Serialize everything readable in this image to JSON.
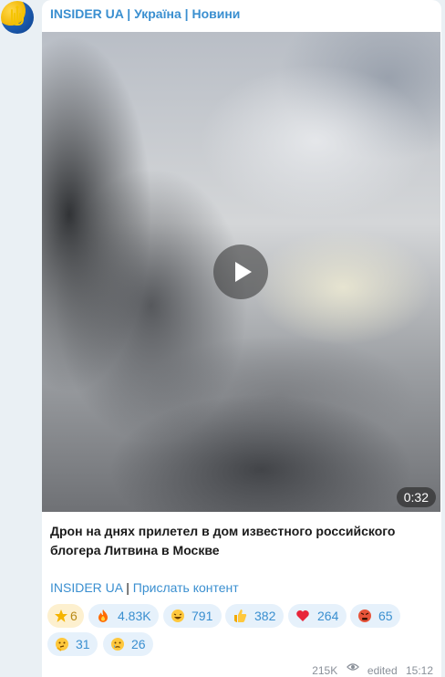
{
  "channel": {
    "name": "INSIDER UA | Україна | Новини"
  },
  "video": {
    "duration": "0:32"
  },
  "message": {
    "text": "Дрон на днях прилетел в дом известного российского блогера Литвина в Москве"
  },
  "links": {
    "channel_link": "INSIDER UA",
    "separator": "|",
    "submit_link": "Прислать контент"
  },
  "reactions": [
    {
      "emoji_name": "star-icon",
      "count": "6"
    },
    {
      "emoji_name": "fire-icon",
      "count": "4.83K"
    },
    {
      "emoji_name": "laughing-face-icon",
      "count": "791"
    },
    {
      "emoji_name": "thumbs-up-icon",
      "count": "382"
    },
    {
      "emoji_name": "heart-icon",
      "count": "264"
    },
    {
      "emoji_name": "angry-face-icon",
      "count": "65"
    },
    {
      "emoji_name": "thinking-face-icon",
      "count": "31"
    },
    {
      "emoji_name": "crying-face-icon",
      "count": "26"
    }
  ],
  "meta": {
    "views": "215K",
    "edited_label": "edited",
    "time": "15:12"
  },
  "colors": {
    "accent": "#3a8fd0",
    "background": "#eaf0f4",
    "reaction_bg": "#e6f1fb"
  }
}
